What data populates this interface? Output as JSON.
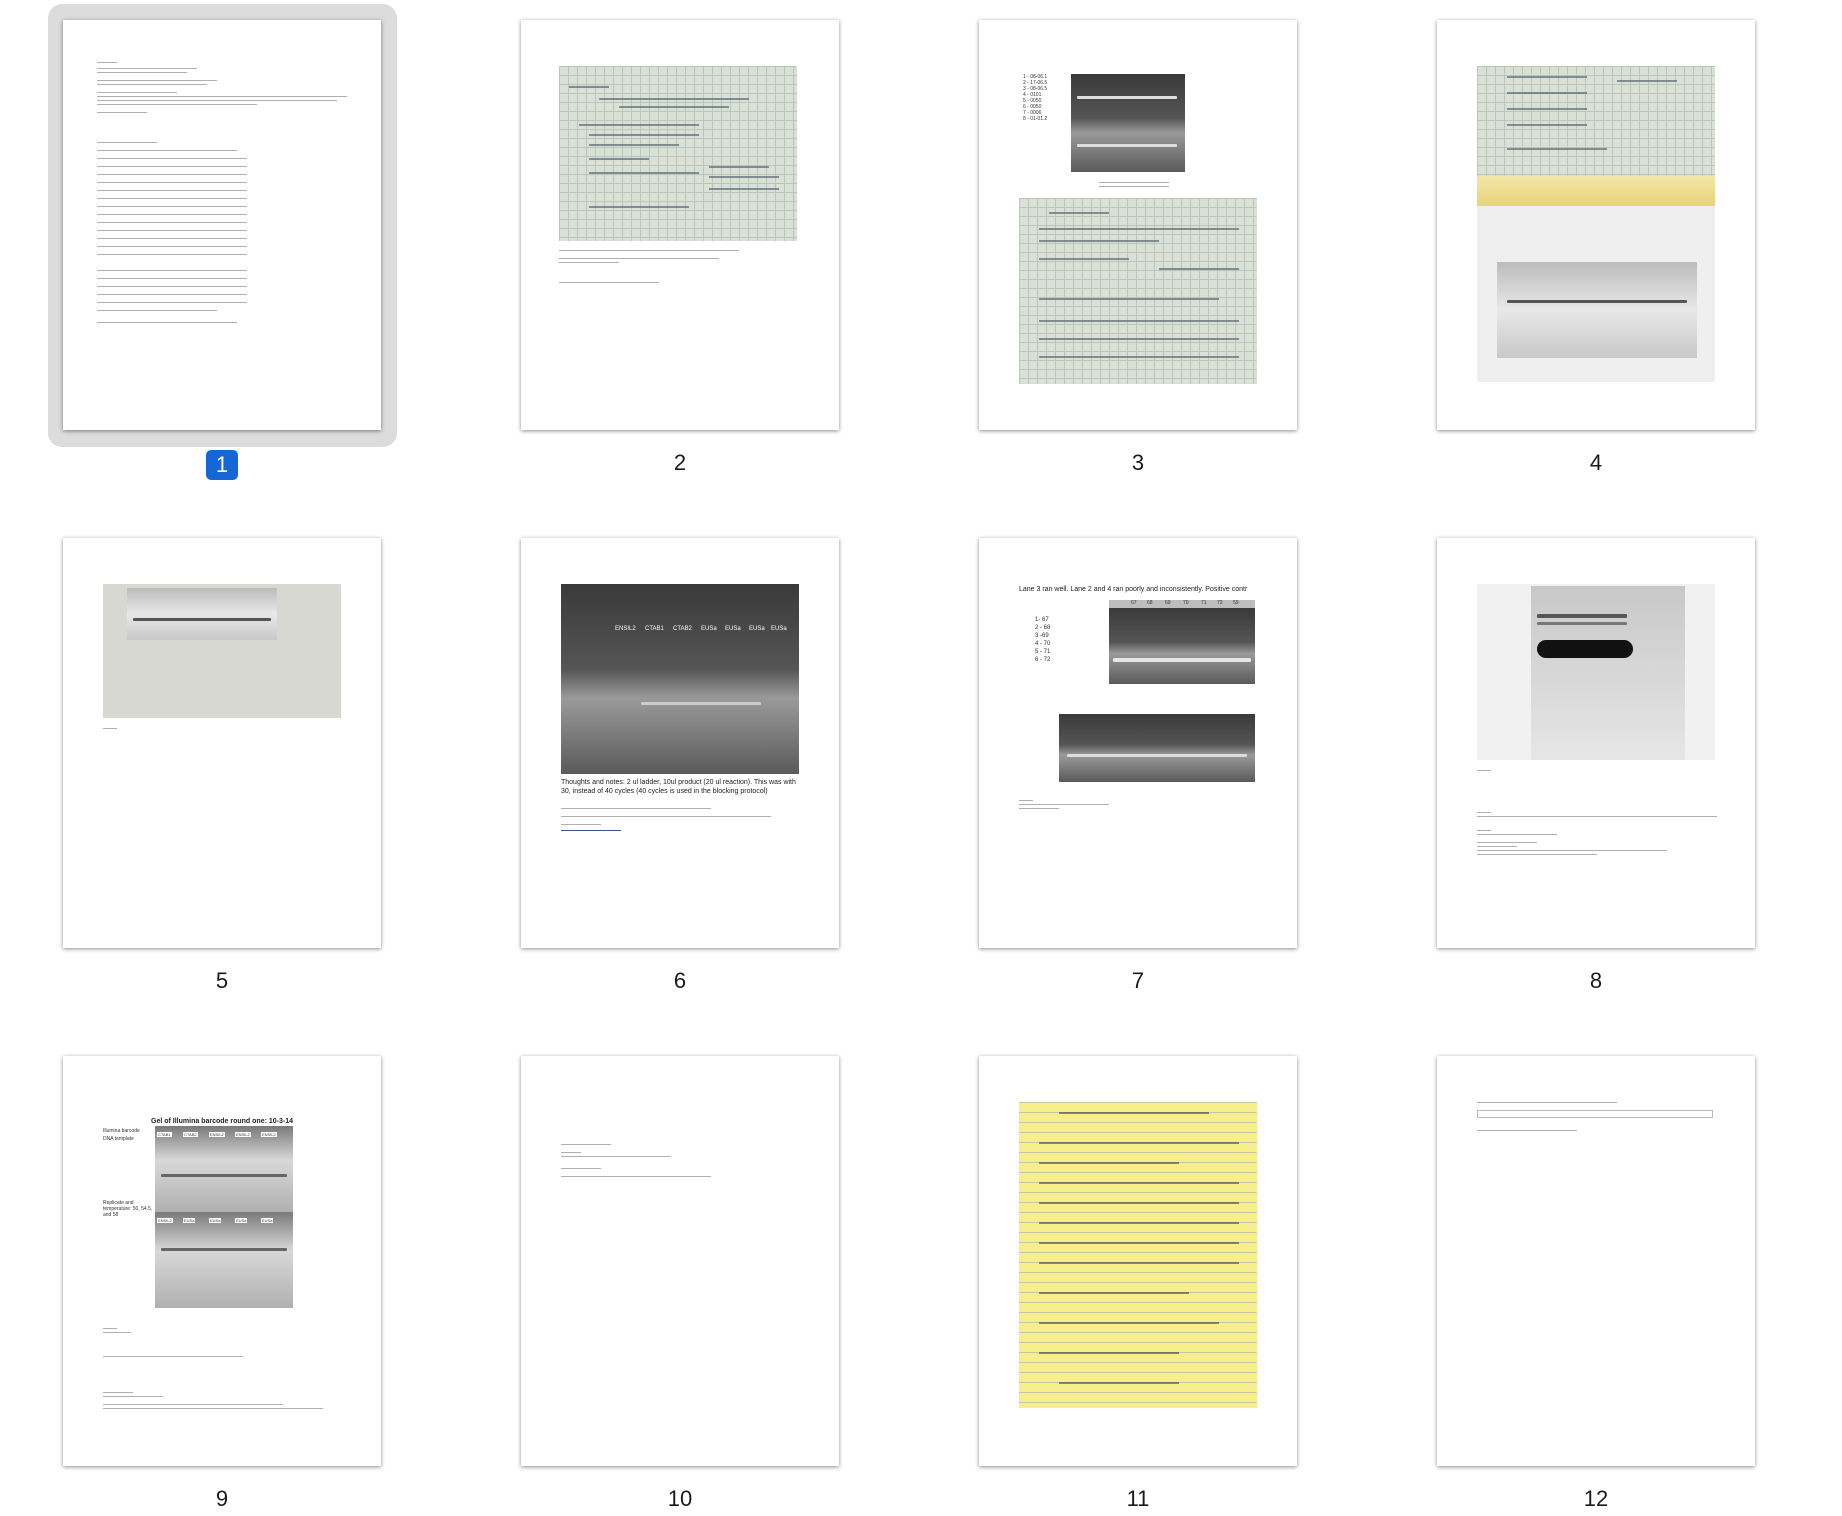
{
  "thumbnails": [
    {
      "number": "1",
      "selected": true
    },
    {
      "number": "2",
      "selected": false
    },
    {
      "number": "3",
      "selected": false
    },
    {
      "number": "4",
      "selected": false
    },
    {
      "number": "5",
      "selected": false
    },
    {
      "number": "6",
      "selected": false
    },
    {
      "number": "7",
      "selected": false
    },
    {
      "number": "8",
      "selected": false
    },
    {
      "number": "9",
      "selected": false
    },
    {
      "number": "10",
      "selected": false
    },
    {
      "number": "11",
      "selected": false
    },
    {
      "number": "12",
      "selected": false
    }
  ],
  "page3": {
    "lane_list": [
      "1 - 08-06.1",
      "2 - 17-06.5",
      "3 - 08-06.5",
      "4 - 0101",
      "5 - 0050",
      "6 - 0050",
      "7 - 0006",
      "8 - 01-01.2"
    ]
  },
  "page6": {
    "lane_labels": [
      "ENSIL2",
      "CTAB1",
      "CTAB2",
      "EUSa",
      "EUSa",
      "EUSa",
      "EUSa"
    ],
    "caption": "Thoughts and notes:  2 ul ladder, 10ul product (20 ul reaction).  This was with 30, instead of 40 cycles (40 cycles is used in the blocking protocol)"
  },
  "page7": {
    "header": "Lane 3 ran well.  Lane 2 and 4 ran poorly and inconsistently.  Positive contr",
    "lanes": [
      "1- 67",
      "2 - 68",
      "3 -69",
      "4 - 70",
      "5 - 71",
      "6 - 72"
    ],
    "gel_labels": [
      "67",
      "68",
      "69",
      "70",
      "71",
      "72",
      "59"
    ]
  },
  "page9": {
    "title": "Gel of Illumina barcode round one: 10-3-14",
    "row1_label": "Illumina barcode",
    "row1_sub": "DNA template",
    "row2_label": "Replicate and temperature: 50, 54.5, and 58",
    "top_lanes": [
      "CTAB1",
      "CTAB2",
      "ENSIL2",
      "ENSIL2",
      "ENSIL2"
    ],
    "bottom_lanes": [
      "ENSIL2",
      "EUSa",
      "EUSa",
      "EUSa",
      "EUSa"
    ]
  },
  "colors": {
    "selection_badge": "#1467d4",
    "selection_halo": "#dcdcdc",
    "page_shadow": "#7a7a7a"
  }
}
